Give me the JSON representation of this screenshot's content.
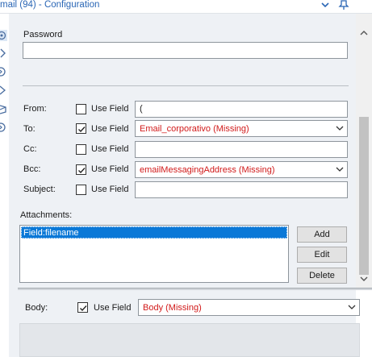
{
  "window": {
    "title": "mail (94) - Configuration"
  },
  "password": {
    "label": "Password",
    "value": ""
  },
  "fields": [
    {
      "label": "From:",
      "use_field_label": "Use Field",
      "checked": false,
      "value": "("
    },
    {
      "label": "To:",
      "use_field_label": "Use Field",
      "checked": true,
      "value": "Email_corporativo (Missing)"
    },
    {
      "label": "Cc:",
      "use_field_label": "Use Field",
      "checked": false,
      "value": ""
    },
    {
      "label": "Bcc:",
      "use_field_label": "Use Field",
      "checked": true,
      "value": "emailMessagingAddress (Missing)"
    },
    {
      "label": "Subject:",
      "use_field_label": "Use Field",
      "checked": false,
      "value": ""
    }
  ],
  "attachments": {
    "label": "Attachments:",
    "items": [
      "Field:filename"
    ],
    "add_label": "Add",
    "edit_label": "Edit",
    "delete_label": "Delete"
  },
  "body": {
    "label": "Body:",
    "use_field_label": "Use Field",
    "checked": true,
    "value": "Body (Missing)"
  },
  "colors": {
    "missing_text": "#d11a1a",
    "title_text": "#2a66b5",
    "selection": "#0a78d7",
    "panel_bg": "#eef1f5"
  },
  "icons": [
    "chevron-down-icon",
    "pin-icon",
    "gear-icon",
    "chevron-right-icon",
    "circle-arrow-icon",
    "diamond-icon",
    "box-icon",
    "circle-arrow-icon",
    "checkbox-checkmark-icon",
    "dropdown-arrow-icon",
    "scroll-up-icon",
    "scroll-down-icon"
  ]
}
